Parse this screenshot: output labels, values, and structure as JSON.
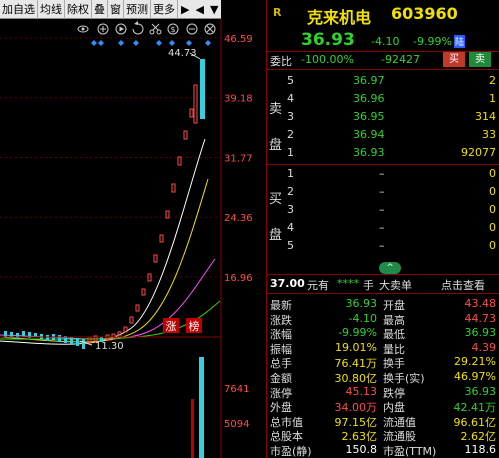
{
  "toolbar": {
    "items": [
      "加自选",
      "均线",
      "除权",
      "叠",
      "窗",
      "预测",
      "更多"
    ],
    "arrows": [
      "▶",
      "◀"
    ],
    "dropdown": "▼"
  },
  "chart": {
    "price_labels": [
      "46.59",
      "39.18",
      "31.77",
      "24.36",
      "16.96"
    ],
    "high_label": "44.73",
    "low_label": "11.30",
    "volume_labels": [
      "7641",
      "5094"
    ],
    "tag_zhang": "涨",
    "tag_bang": "榜"
  },
  "chart_data": {
    "type": "candlestick",
    "ylim": [
      9.5,
      46.59
    ],
    "y_ticks": [
      46.59,
      39.18,
      31.77,
      24.36,
      16.96
    ],
    "annotations": {
      "high": 44.73,
      "low": 11.3
    },
    "volume_ticks": [
      7641,
      5094
    ]
  },
  "quote": {
    "r_icon": "R",
    "name": "克来机电",
    "code": "603960",
    "price": "36.93",
    "change": "-4.10",
    "change_pct": "-9.99%",
    "tag": "陆",
    "weibi_label": "委比",
    "weibi_value": "-100.00%",
    "weicha_value": "-92427",
    "buy_btn": "买",
    "sell_btn": "卖"
  },
  "asks_label": [
    "卖",
    "盘"
  ],
  "bids_label": [
    "买",
    "盘"
  ],
  "asks": [
    {
      "level": "5",
      "price": "36.97",
      "vol": "2"
    },
    {
      "level": "4",
      "price": "36.96",
      "vol": "1"
    },
    {
      "level": "3",
      "price": "36.95",
      "vol": "314"
    },
    {
      "level": "2",
      "price": "36.94",
      "vol": "33"
    },
    {
      "level": "1",
      "price": "36.93",
      "vol": "92077"
    }
  ],
  "bids": [
    {
      "level": "1",
      "price": "–",
      "vol": "0"
    },
    {
      "level": "2",
      "price": "–",
      "vol": "0"
    },
    {
      "level": "3",
      "price": "–",
      "vol": "0"
    },
    {
      "level": "4",
      "price": "–",
      "vol": "0"
    },
    {
      "level": "5",
      "price": "–",
      "vol": "0"
    }
  ],
  "big_order": {
    "price": "37.00",
    "unit_yuan": "元有",
    "stars": "****",
    "unit_shou": "手",
    "label": "大卖单",
    "link": "点击查看"
  },
  "stats": [
    {
      "l1": "最新",
      "v1": "36.93",
      "c1": "green",
      "l2": "开盘",
      "v2": "43.48",
      "c2": "red"
    },
    {
      "l1": "涨跌",
      "v1": "-4.10",
      "c1": "green",
      "l2": "最高",
      "v2": "44.73",
      "c2": "red"
    },
    {
      "l1": "涨幅",
      "v1": "-9.99%",
      "c1": "green",
      "l2": "最低",
      "v2": "36.93",
      "c2": "green"
    },
    {
      "l1": "振幅",
      "v1": "19.01%",
      "c1": "yellow",
      "l2": "量比",
      "v2": "4.39",
      "c2": "red"
    },
    {
      "l1": "总手",
      "v1": "76.41万",
      "c1": "yellow",
      "l2": "换手",
      "v2": "29.21%",
      "c2": "yellow"
    },
    {
      "l1": "金额",
      "v1": "30.80亿",
      "c1": "yellow",
      "l2": "换手(实)",
      "v2": "46.97%",
      "c2": "yellow"
    },
    {
      "l1": "涨停",
      "v1": "45.13",
      "c1": "red",
      "l2": "跌停",
      "v2": "36.93",
      "c2": "green"
    },
    {
      "l1": "外盘",
      "v1": "34.00万",
      "c1": "red",
      "l2": "内盘",
      "v2": "42.41万",
      "c2": "green"
    },
    {
      "l1": "总市值",
      "v1": "97.15亿",
      "c1": "yellow",
      "l2": "流通值",
      "v2": "96.61亿",
      "c2": "yellow"
    },
    {
      "l1": "总股本",
      "v1": "2.63亿",
      "c1": "yellow",
      "l2": "流通股",
      "v2": "2.62亿",
      "c2": "yellow"
    },
    {
      "l1": "市盈(静)",
      "v1": "150.8",
      "c1": "white",
      "l2": "市盈(TTM)",
      "v2": "118.6",
      "c2": "white"
    }
  ],
  "colors": {
    "up": "#ff4b4b",
    "down": "#2fd32f",
    "divider": "#8b0000",
    "ma5": "#ffffff",
    "ma10": "#f0e000",
    "ma20": "#ff50ff",
    "ma60": "#3ad000"
  }
}
